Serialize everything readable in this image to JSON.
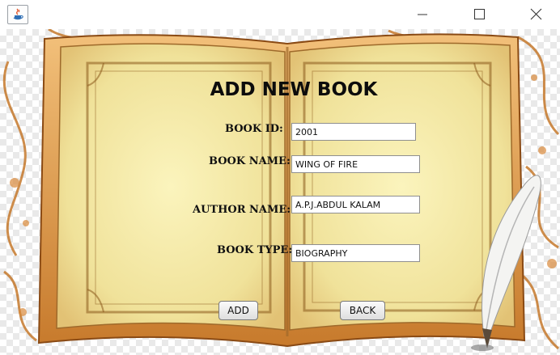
{
  "window": {
    "app_icon": "java-icon",
    "controls": {
      "minimize": "minimize-icon",
      "maximize": "maximize-icon",
      "close": "close-icon"
    }
  },
  "form": {
    "title": "ADD NEW BOOK",
    "book_id": {
      "label": "BOOK ID:",
      "value": "2001"
    },
    "book_name": {
      "label": "BOOK NAME:",
      "value": "WING OF FIRE"
    },
    "author_name": {
      "label": "AUTHOR NAME:",
      "value": "A.P.J.ABDUL KALAM"
    },
    "book_type": {
      "label": "BOOK TYPE:",
      "value": "BIOGRAPHY"
    },
    "add_label": "ADD",
    "back_label": "BACK"
  },
  "colors": {
    "page": "#f3e9a6",
    "book_edge": "#c47a2a",
    "border_ornament": "#8a4a14"
  }
}
